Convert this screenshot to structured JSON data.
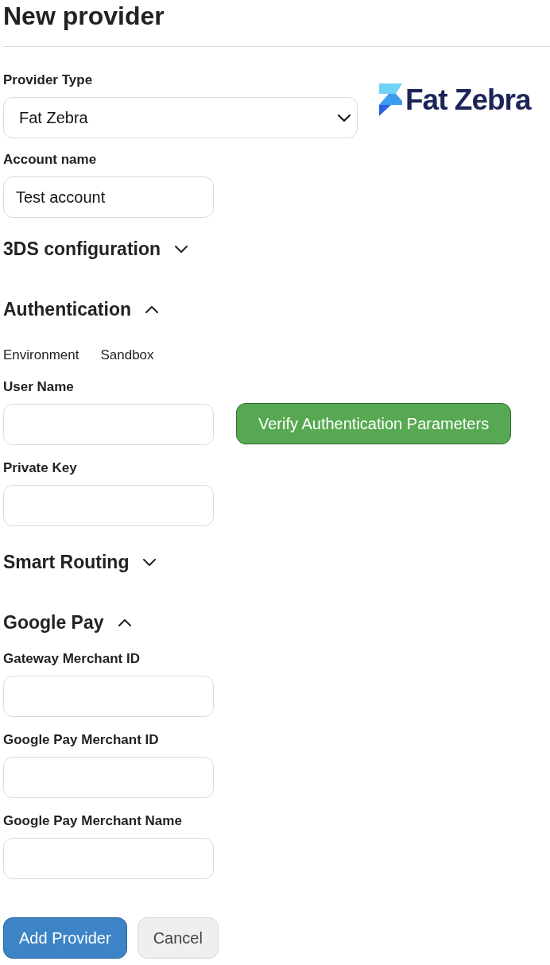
{
  "title": "New provider",
  "provider_type": {
    "label": "Provider Type",
    "value": "Fat Zebra"
  },
  "logo": {
    "text": "Fat Zebra"
  },
  "account_name": {
    "label": "Account name",
    "value": "Test account"
  },
  "sections": [
    {
      "title": "3DS configuration",
      "expanded": false
    },
    {
      "title": "Authentication",
      "expanded": true,
      "items": [
        {
          "kind": "info",
          "label": "Environment",
          "value": "Sandbox"
        },
        {
          "kind": "field",
          "label": "User Name",
          "button": "Verify Authentication Parameters"
        },
        {
          "kind": "field",
          "label": "Private Key"
        }
      ]
    },
    {
      "title": "Smart Routing",
      "expanded": false
    },
    {
      "title": "Google Pay",
      "expanded": true,
      "items": [
        {
          "kind": "field",
          "label": "Gateway Merchant ID"
        },
        {
          "kind": "field",
          "label": "Google Pay Merchant ID"
        },
        {
          "kind": "field",
          "label": "Google Pay Merchant Name"
        }
      ]
    }
  ],
  "buttons": [
    {
      "label": "Add Provider",
      "kind": "primary"
    },
    {
      "label": "Cancel",
      "kind": "secondary"
    }
  ]
}
